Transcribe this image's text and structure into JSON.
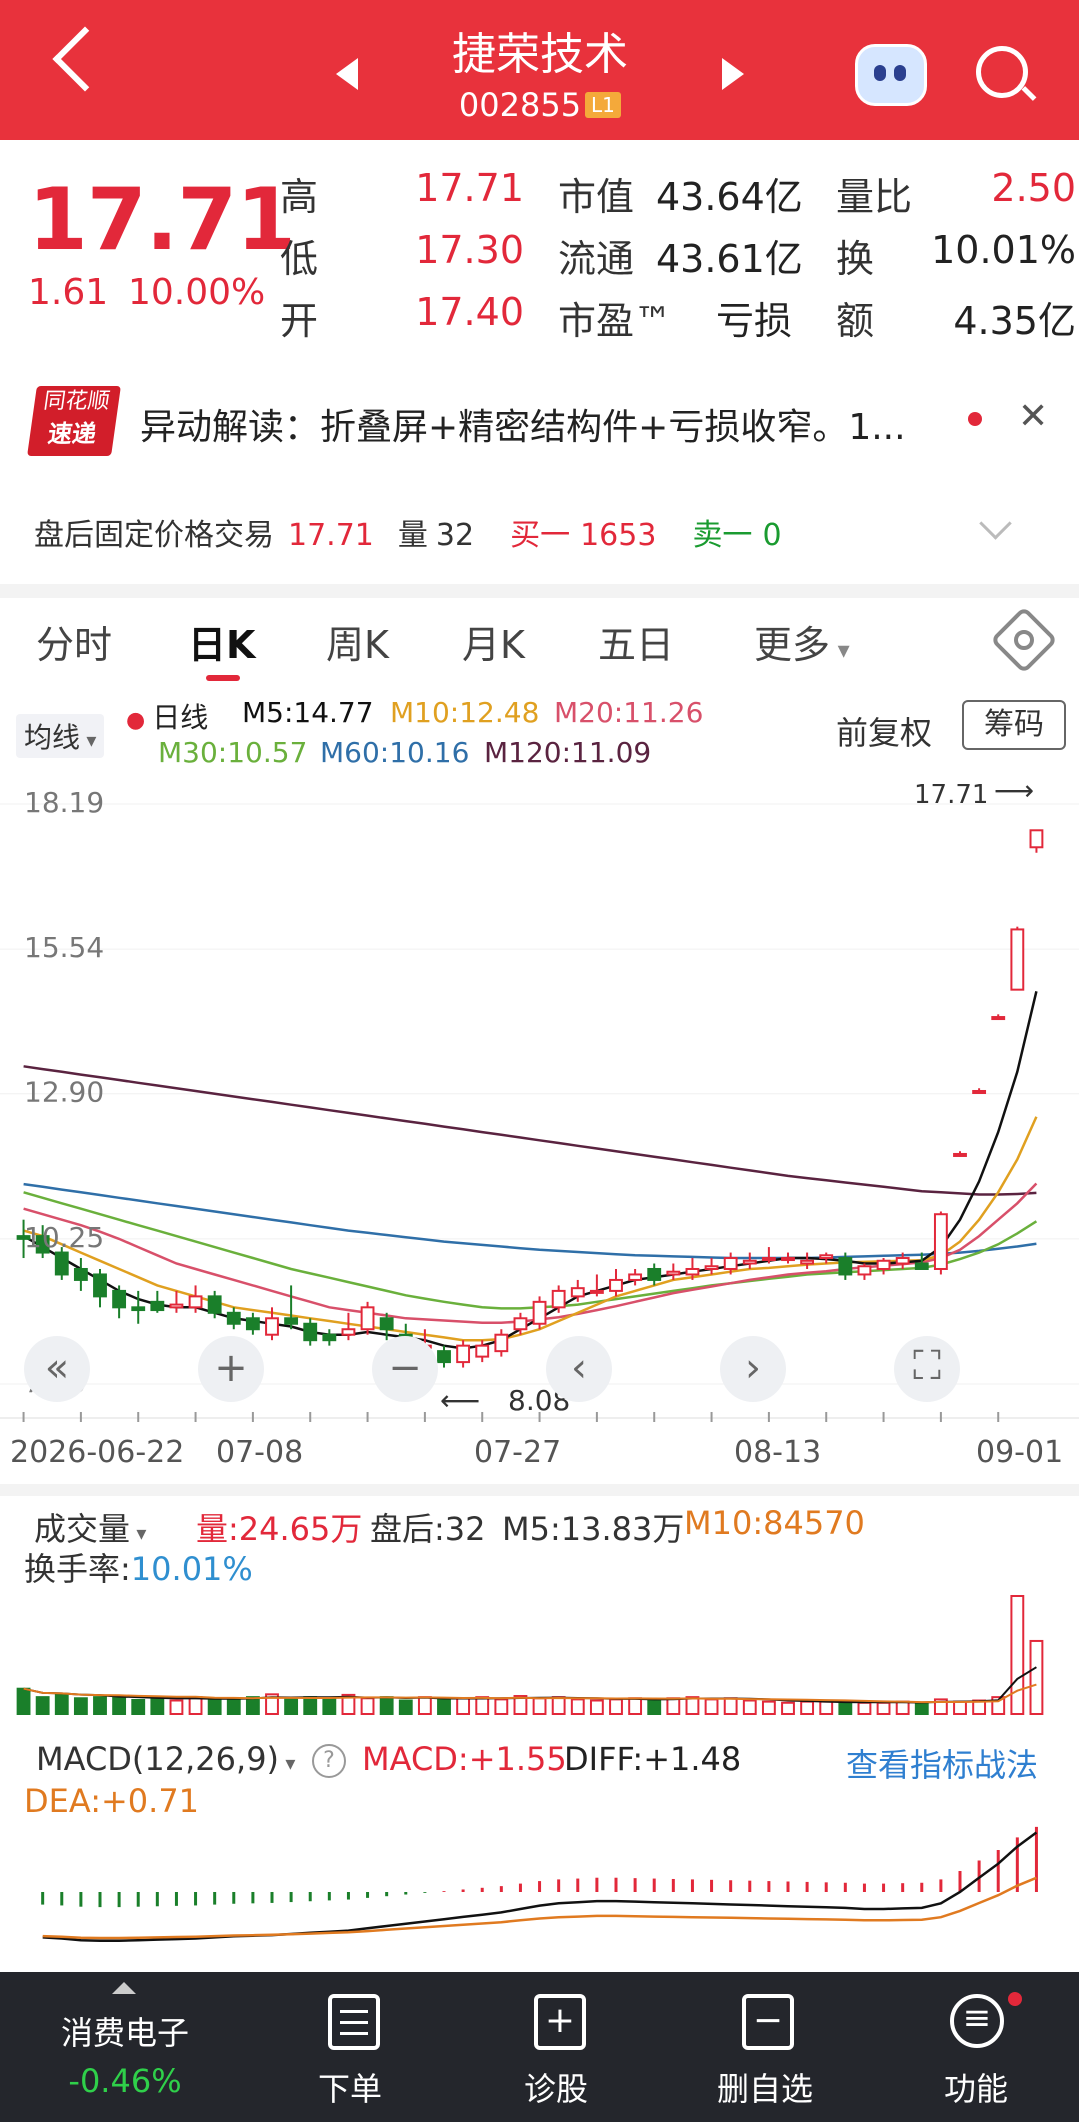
{
  "header": {
    "title": "捷荣技术",
    "code": "002855",
    "level": "L1"
  },
  "quote": {
    "price": "17.71",
    "change": "1.61",
    "change_pct": "10.00%",
    "high_label": "高",
    "high": "17.71",
    "low_label": "低",
    "low": "17.30",
    "open_label": "开",
    "open": "17.40",
    "mcap_label": "市值",
    "mcap": "43.64亿",
    "float_label": "流通",
    "float": "43.61亿",
    "pe_label": "市盈™",
    "pe": "亏损",
    "vr_label": "量比",
    "vr": "2.50",
    "turn_label": "换",
    "turn": "10.01%",
    "amt_label": "额",
    "amt": "4.35亿"
  },
  "news": {
    "logo_top": "同花顺",
    "logo_bottom": "速递",
    "text": "异动解读：折叠屏+精密结构件+亏损收窄。1..."
  },
  "after_hours": {
    "label": "盘后固定价格交易",
    "price": "17.71",
    "vol_label": "量",
    "vol": "32",
    "buy_label": "买一",
    "buy": "1653",
    "sell_label": "卖一",
    "sell": "0"
  },
  "tabs": [
    "分时",
    "日K",
    "周K",
    "月K",
    "五日",
    "更多"
  ],
  "legend": {
    "ma_btn": "均线",
    "day_line": "日线",
    "m5": "M5:14.77",
    "m10": "M10:12.48",
    "m20": "M20:11.26",
    "m30": "M30:10.57",
    "m60": "M60:10.16",
    "m120": "M120:11.09",
    "fq": "前复权",
    "chip": "筹码",
    "colors": {
      "m5": "#111111",
      "m10": "#e0a020",
      "m20": "#d8506a",
      "m30": "#6ab03c",
      "m60": "#2f6fa8",
      "m120": "#5a2340"
    }
  },
  "kchart": {
    "y_ticks": [
      "18.19",
      "15.54",
      "12.90",
      "10.25",
      "7.60"
    ],
    "x_ticks": [
      "2026-06-22",
      "07-08",
      "07-27",
      "08-13",
      "09-01"
    ],
    "max_label": "17.71",
    "min_label": "8.08",
    "controls": [
      "«",
      "+",
      "−",
      "‹",
      "›"
    ]
  },
  "volume": {
    "label": "成交量",
    "vol": "量:24.65万",
    "after": "盘后:32",
    "m5": "M5:13.83万",
    "m10": "M10:84570",
    "turnover_label": "换手率:",
    "turnover": "10.01%"
  },
  "macd": {
    "label": "MACD(12,26,9)",
    "macd": "MACD:+1.55",
    "diff": "DIFF:+1.48",
    "dea": "DEA:+0.71",
    "link": "查看指标战法"
  },
  "bottom": {
    "sector": "消费电子",
    "sector_pct": "-0.46%",
    "order": "下单",
    "diag": "诊股",
    "del": "删自选",
    "func": "功能"
  },
  "chart_data": {
    "type": "candlestick",
    "x_range": [
      "2026-06-22",
      "2026-09-01"
    ],
    "ylim": [
      7.6,
      18.19
    ],
    "candles": [
      {
        "o": 10.3,
        "c": 10.25,
        "h": 10.6,
        "l": 9.9
      },
      {
        "o": 10.3,
        "c": 10.0,
        "h": 10.5,
        "l": 9.9
      },
      {
        "o": 10.0,
        "c": 9.6,
        "h": 10.1,
        "l": 9.5
      },
      {
        "o": 9.7,
        "c": 9.5,
        "h": 9.9,
        "l": 9.3
      },
      {
        "o": 9.6,
        "c": 9.2,
        "h": 9.7,
        "l": 9.0
      },
      {
        "o": 9.3,
        "c": 9.0,
        "h": 9.4,
        "l": 8.8
      },
      {
        "o": 9.0,
        "c": 8.95,
        "h": 9.3,
        "l": 8.7
      },
      {
        "o": 9.1,
        "c": 8.95,
        "h": 9.3,
        "l": 8.9
      },
      {
        "o": 9.0,
        "c": 9.05,
        "h": 9.3,
        "l": 8.9
      },
      {
        "o": 9.0,
        "c": 9.2,
        "h": 9.4,
        "l": 8.9
      },
      {
        "o": 9.2,
        "c": 8.9,
        "h": 9.3,
        "l": 8.8
      },
      {
        "o": 8.9,
        "c": 8.7,
        "h": 9.0,
        "l": 8.6
      },
      {
        "o": 8.8,
        "c": 8.6,
        "h": 8.9,
        "l": 8.5
      },
      {
        "o": 8.5,
        "c": 8.8,
        "h": 9.0,
        "l": 8.4
      },
      {
        "o": 8.8,
        "c": 8.7,
        "h": 9.4,
        "l": 8.6
      },
      {
        "o": 8.7,
        "c": 8.4,
        "h": 8.8,
        "l": 8.3
      },
      {
        "o": 8.5,
        "c": 8.4,
        "h": 8.6,
        "l": 8.3
      },
      {
        "o": 8.5,
        "c": 8.6,
        "h": 8.9,
        "l": 8.4
      },
      {
        "o": 8.6,
        "c": 9.0,
        "h": 9.1,
        "l": 8.5
      },
      {
        "o": 8.8,
        "c": 8.6,
        "h": 8.9,
        "l": 8.4
      },
      {
        "o": 8.5,
        "c": 8.2,
        "h": 8.7,
        "l": 8.1
      },
      {
        "o": 8.3,
        "c": 8.3,
        "h": 8.6,
        "l": 8.08
      },
      {
        "o": 8.2,
        "c": 8.0,
        "h": 8.3,
        "l": 7.9
      },
      {
        "o": 8.0,
        "c": 8.3,
        "h": 8.4,
        "l": 7.9
      },
      {
        "o": 8.1,
        "c": 8.3,
        "h": 8.4,
        "l": 8.0
      },
      {
        "o": 8.2,
        "c": 8.5,
        "h": 8.6,
        "l": 8.1
      },
      {
        "o": 8.6,
        "c": 8.8,
        "h": 8.9,
        "l": 8.5
      },
      {
        "o": 8.7,
        "c": 9.1,
        "h": 9.2,
        "l": 8.6
      },
      {
        "o": 9.0,
        "c": 9.3,
        "h": 9.4,
        "l": 8.9
      },
      {
        "o": 9.2,
        "c": 9.35,
        "h": 9.5,
        "l": 9.1
      },
      {
        "o": 9.3,
        "c": 9.3,
        "h": 9.6,
        "l": 9.2
      },
      {
        "o": 9.3,
        "c": 9.5,
        "h": 9.7,
        "l": 9.2
      },
      {
        "o": 9.5,
        "c": 9.6,
        "h": 9.7,
        "l": 9.4
      },
      {
        "o": 9.7,
        "c": 9.5,
        "h": 9.8,
        "l": 9.4
      },
      {
        "o": 9.6,
        "c": 9.65,
        "h": 9.8,
        "l": 9.5
      },
      {
        "o": 9.6,
        "c": 9.7,
        "h": 9.9,
        "l": 9.5
      },
      {
        "o": 9.7,
        "c": 9.75,
        "h": 9.9,
        "l": 9.6
      },
      {
        "o": 9.7,
        "c": 9.9,
        "h": 10.0,
        "l": 9.6
      },
      {
        "o": 9.8,
        "c": 9.85,
        "h": 10.0,
        "l": 9.7
      },
      {
        "o": 9.9,
        "c": 9.9,
        "h": 10.1,
        "l": 9.8
      },
      {
        "o": 9.9,
        "c": 9.9,
        "h": 10.0,
        "l": 9.8
      },
      {
        "o": 9.8,
        "c": 9.85,
        "h": 10.0,
        "l": 9.7
      },
      {
        "o": 9.9,
        "c": 9.95,
        "h": 10.0,
        "l": 9.8
      },
      {
        "o": 9.9,
        "c": 9.6,
        "h": 10.0,
        "l": 9.5
      },
      {
        "o": 9.6,
        "c": 9.75,
        "h": 9.8,
        "l": 9.5
      },
      {
        "o": 9.7,
        "c": 9.85,
        "h": 9.9,
        "l": 9.6
      },
      {
        "o": 9.8,
        "c": 9.9,
        "h": 10.0,
        "l": 9.7
      },
      {
        "o": 9.8,
        "c": 9.7,
        "h": 10.0,
        "l": 9.7
      },
      {
        "o": 9.7,
        "c": 10.7,
        "h": 10.75,
        "l": 9.6
      },
      {
        "o": 11.8,
        "c": 11.8,
        "h": 11.85,
        "l": 11.75
      },
      {
        "o": 12.95,
        "c": 12.95,
        "h": 13.0,
        "l": 12.9
      },
      {
        "o": 14.3,
        "c": 14.3,
        "h": 14.35,
        "l": 14.25
      },
      {
        "o": 14.8,
        "c": 15.9,
        "h": 15.95,
        "l": 14.8
      },
      {
        "o": 17.4,
        "c": 17.71,
        "h": 17.71,
        "l": 17.3
      }
    ],
    "ma": {
      "m5": [
        10.3,
        10.1,
        9.9,
        9.7,
        9.5,
        9.3,
        9.15,
        9.05,
        9.0,
        9.0,
        8.9,
        8.8,
        8.75,
        8.7,
        8.65,
        8.55,
        8.5,
        8.5,
        8.55,
        8.5,
        8.45,
        8.4,
        8.3,
        8.25,
        8.3,
        8.4,
        8.6,
        8.8,
        9.0,
        9.2,
        9.3,
        9.4,
        9.5,
        9.55,
        9.6,
        9.65,
        9.7,
        9.75,
        9.8,
        9.85,
        9.9,
        9.9,
        9.88,
        9.85,
        9.8,
        9.8,
        9.82,
        9.85,
        10.1,
        10.6,
        11.3,
        12.2,
        13.3,
        14.77
      ],
      "m10": [
        10.4,
        10.3,
        10.15,
        10.0,
        9.85,
        9.7,
        9.55,
        9.4,
        9.3,
        9.2,
        9.1,
        9.0,
        8.95,
        8.9,
        8.85,
        8.8,
        8.75,
        8.7,
        8.65,
        8.6,
        8.55,
        8.5,
        8.45,
        8.4,
        8.4,
        8.42,
        8.5,
        8.6,
        8.75,
        8.9,
        9.05,
        9.2,
        9.3,
        9.4,
        9.5,
        9.55,
        9.6,
        9.65,
        9.7,
        9.72,
        9.75,
        9.78,
        9.8,
        9.82,
        9.83,
        9.84,
        9.85,
        9.86,
        9.95,
        10.2,
        10.6,
        11.1,
        11.7,
        12.48
      ],
      "m20": [
        10.8,
        10.7,
        10.6,
        10.5,
        10.38,
        10.25,
        10.1,
        9.95,
        9.8,
        9.7,
        9.6,
        9.5,
        9.4,
        9.3,
        9.2,
        9.1,
        9.0,
        8.95,
        8.9,
        8.85,
        8.8,
        8.78,
        8.76,
        8.74,
        8.72,
        8.72,
        8.74,
        8.78,
        8.82,
        8.88,
        8.95,
        9.02,
        9.1,
        9.18,
        9.26,
        9.32,
        9.38,
        9.44,
        9.5,
        9.55,
        9.6,
        9.63,
        9.66,
        9.7,
        9.73,
        9.76,
        9.79,
        9.82,
        9.9,
        10.05,
        10.3,
        10.6,
        10.9,
        11.26
      ],
      "m30": [
        11.1,
        11.0,
        10.9,
        10.8,
        10.7,
        10.6,
        10.5,
        10.4,
        10.3,
        10.2,
        10.1,
        10.0,
        9.9,
        9.8,
        9.7,
        9.62,
        9.54,
        9.46,
        9.38,
        9.3,
        9.22,
        9.16,
        9.1,
        9.05,
        9.0,
        8.98,
        8.98,
        9.0,
        9.02,
        9.05,
        9.1,
        9.15,
        9.2,
        9.25,
        9.3,
        9.35,
        9.4,
        9.44,
        9.48,
        9.52,
        9.56,
        9.6,
        9.62,
        9.64,
        9.66,
        9.68,
        9.7,
        9.72,
        9.78,
        9.88,
        10.0,
        10.15,
        10.35,
        10.57
      ],
      "m60": [
        11.25,
        11.2,
        11.15,
        11.1,
        11.05,
        11.0,
        10.95,
        10.9,
        10.85,
        10.8,
        10.75,
        10.7,
        10.65,
        10.6,
        10.55,
        10.5,
        10.45,
        10.4,
        10.36,
        10.32,
        10.28,
        10.24,
        10.2,
        10.17,
        10.14,
        10.11,
        10.08,
        10.05,
        10.03,
        10.01,
        9.99,
        9.97,
        9.95,
        9.94,
        9.93,
        9.92,
        9.91,
        9.9,
        9.9,
        9.9,
        9.9,
        9.9,
        9.91,
        9.92,
        9.93,
        9.94,
        9.95,
        9.96,
        9.98,
        10.0,
        10.03,
        10.07,
        10.11,
        10.16
      ],
      "m120": [
        13.4,
        13.35,
        13.3,
        13.25,
        13.2,
        13.15,
        13.1,
        13.05,
        13.0,
        12.95,
        12.9,
        12.85,
        12.8,
        12.75,
        12.7,
        12.65,
        12.6,
        12.55,
        12.5,
        12.45,
        12.4,
        12.35,
        12.3,
        12.25,
        12.2,
        12.15,
        12.1,
        12.05,
        12.0,
        11.95,
        11.9,
        11.85,
        11.8,
        11.75,
        11.7,
        11.65,
        11.6,
        11.55,
        11.5,
        11.45,
        11.4,
        11.36,
        11.32,
        11.28,
        11.24,
        11.2,
        11.16,
        11.12,
        11.1,
        11.08,
        11.06,
        11.06,
        11.07,
        11.09
      ]
    },
    "volume": [
      0.45,
      0.3,
      0.35,
      0.28,
      0.3,
      0.32,
      0.25,
      0.28,
      0.24,
      0.3,
      0.28,
      0.26,
      0.3,
      0.35,
      0.28,
      0.3,
      0.26,
      0.34,
      0.28,
      0.3,
      0.24,
      0.3,
      0.26,
      0.28,
      0.3,
      0.26,
      0.32,
      0.28,
      0.3,
      0.26,
      0.24,
      0.26,
      0.28,
      0.26,
      0.28,
      0.3,
      0.26,
      0.28,
      0.24,
      0.22,
      0.2,
      0.22,
      0.22,
      0.2,
      0.2,
      0.2,
      0.22,
      0.2,
      0.26,
      0.22,
      0.24,
      0.3,
      2.1,
      1.3
    ],
    "macd": [
      -0.3,
      -0.32,
      -0.35,
      -0.36,
      -0.36,
      -0.35,
      -0.34,
      -0.33,
      -0.32,
      -0.3,
      -0.28,
      -0.27,
      -0.26,
      -0.24,
      -0.22,
      -0.2,
      -0.18,
      -0.14,
      -0.1,
      -0.06,
      -0.02,
      0.02,
      0.06,
      0.1,
      0.14,
      0.2,
      0.26,
      0.3,
      0.32,
      0.34,
      0.34,
      0.33,
      0.32,
      0.31,
      0.3,
      0.29,
      0.28,
      0.27,
      0.26,
      0.25,
      0.24,
      0.23,
      0.22,
      0.2,
      0.2,
      0.21,
      0.22,
      0.3,
      0.5,
      0.75,
      1.0,
      1.3,
      1.55
    ]
  }
}
